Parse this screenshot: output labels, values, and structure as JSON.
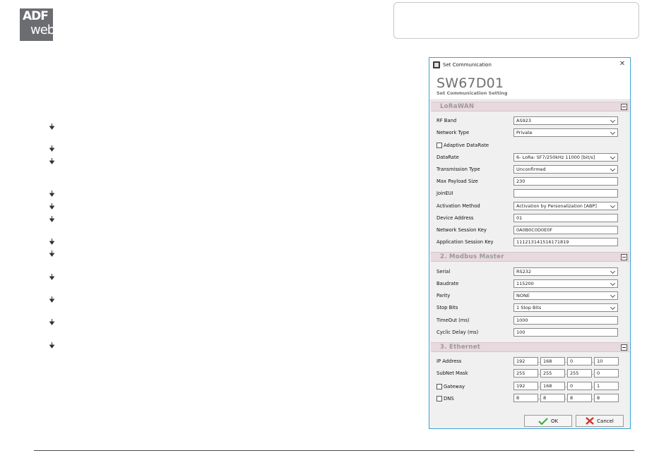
{
  "logo": {
    "line1": "ADF",
    "line2": "web"
  },
  "dialog": {
    "window_title": "Set Communication",
    "device_title": "SW67D01",
    "device_subtitle": "Set Communication Setting",
    "sections": {
      "lorawan": "LoRaWAN",
      "modbus": "2. Modbus Master",
      "ethernet": "3. Ethernet"
    },
    "lorawan": {
      "rf_band": {
        "label": "RF Band",
        "value": "AS923"
      },
      "network_type": {
        "label": "Network Type",
        "value": "Private"
      },
      "adaptive_datarate": {
        "label": "Adaptive DataRate",
        "checked": false
      },
      "datarate": {
        "label": "DataRate",
        "value": "6- LoRa: SF7/250kHz 11000 [bit/s]"
      },
      "transmission_type": {
        "label": "Transmission Type",
        "value": "Unconfirmed"
      },
      "max_payload": {
        "label": "Max Payload Size",
        "value": "230"
      },
      "join_eui": {
        "label": "JoinEUI",
        "value": ""
      },
      "activation_method": {
        "label": "Activation Method",
        "value": "Activation by Personalization [ABP]"
      },
      "device_address": {
        "label": "Device Address",
        "value": "01"
      },
      "network_session_key": {
        "label": "Network Session Key",
        "value": "0A0B0C0D0E0F"
      },
      "app_session_key": {
        "label": "Application Session Key",
        "value": "111213141516171819"
      }
    },
    "modbus": {
      "serial": {
        "label": "Serial",
        "value": "RS232"
      },
      "baudrate": {
        "label": "Baudrate",
        "value": "115200"
      },
      "parity": {
        "label": "Parity",
        "value": "NONE"
      },
      "stop_bits": {
        "label": "Stop Bits",
        "value": "1 Stop Bits"
      },
      "timeout": {
        "label": "TimeOut (ms)",
        "value": "1000"
      },
      "cyclic_delay": {
        "label": "Cyclic Delay (ms)",
        "value": "100"
      }
    },
    "ethernet": {
      "ip": {
        "label": "IP Address",
        "octets": [
          "192",
          "168",
          "0",
          "10"
        ]
      },
      "subnet": {
        "label": "SubNet Mask",
        "octets": [
          "255",
          "255",
          "255",
          "0"
        ]
      },
      "gateway": {
        "label": "Gateway",
        "checked": false,
        "octets": [
          "192",
          "168",
          "0",
          "1"
        ]
      },
      "dns": {
        "label": "DNS",
        "checked": false,
        "octets": [
          "8",
          "8",
          "8",
          "8"
        ]
      }
    },
    "buttons": {
      "ok": "OK",
      "cancel": "Cancel"
    }
  },
  "colors": {
    "window_border": "#3aa3d8",
    "section_header": "#e8d9de",
    "ok_check": "#3cb043",
    "cancel_x": "#d9302b",
    "logo_bg": "#6b6d70"
  }
}
